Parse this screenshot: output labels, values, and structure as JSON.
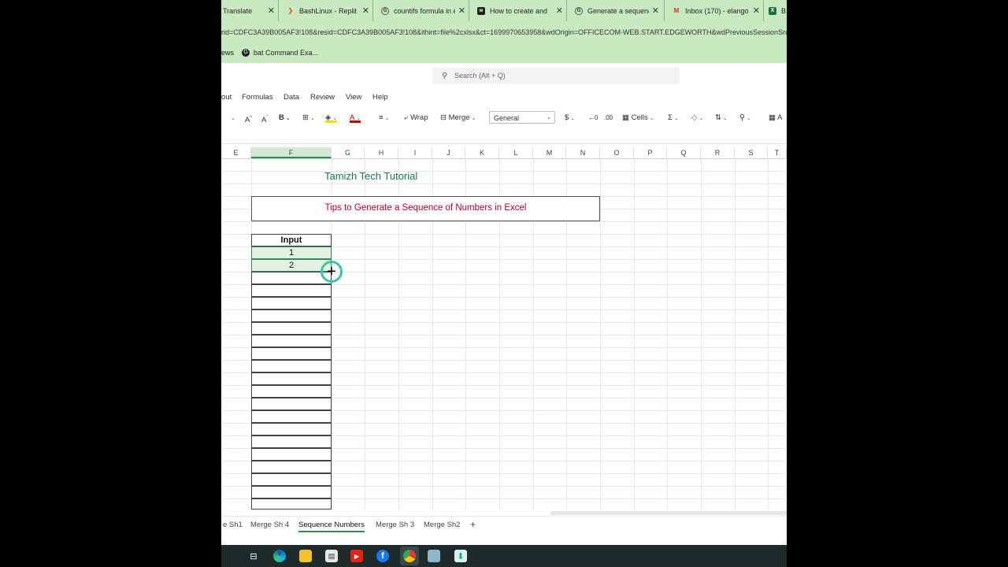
{
  "browser": {
    "tabs": [
      {
        "label": "Translate",
        "icon": "translate-icon"
      },
      {
        "label": "BashLinux - Replit",
        "icon": "replit-icon"
      },
      {
        "label": "countifs formula in e",
        "icon": "google-icon"
      },
      {
        "label": "How to create and m",
        "icon": "site-icon"
      },
      {
        "label": "Generate a sequence",
        "icon": "google-icon"
      },
      {
        "label": "Inbox (170) - elango",
        "icon": "gmail-icon"
      },
      {
        "label": "B",
        "icon": "excel-icon"
      }
    ],
    "url": "rid=CDFC3A39B005AF3!108&resid=CDFC3A39B005AF3!108&ithint=file%2cxlsx&ct=1699970653958&wdOrigin=OFFICECOM-WEB.START.EDGEWORTH&wdPreviousSessionSrc",
    "bookmarks": [
      {
        "label": "ews"
      },
      {
        "label": "bat Command Exa..."
      }
    ]
  },
  "excel": {
    "search_placeholder": "Search (Alt + Q)",
    "menu": [
      "out",
      "Formulas",
      "Data",
      "Review",
      "View",
      "Help"
    ],
    "ribbon": {
      "wrap": "Wrap",
      "merge": "Merge",
      "number_format": "General",
      "currency": "$",
      "cells": "Cells",
      "more": "A"
    },
    "columns": [
      "E",
      "F",
      "G",
      "H",
      "I",
      "J",
      "K",
      "L",
      "M",
      "N",
      "O",
      "P",
      "Q",
      "R",
      "S",
      "T"
    ],
    "selected_column": "F",
    "sheet": {
      "title": "Tamizh Tech Tutorial",
      "subtitle": "Tips to Generate a Sequence of Numbers in Excel",
      "header": "Input",
      "values": [
        "1",
        "2"
      ]
    },
    "sheet_tabs": [
      {
        "label": "e Sh1",
        "active": false
      },
      {
        "label": "Merge Sh 4",
        "active": false
      },
      {
        "label": "Sequence Numbers",
        "active": true
      },
      {
        "label": "Merge Sh 3",
        "active": false
      },
      {
        "label": "Merge Sh2",
        "active": false
      }
    ],
    "add_sheet": "+"
  },
  "colors": {
    "browser_chrome": "#c9e9c0",
    "title_text": "#16784f",
    "subtitle_text": "#c00020",
    "accent": "#2e8b57",
    "cursor_ring": "#3cc4a8"
  }
}
